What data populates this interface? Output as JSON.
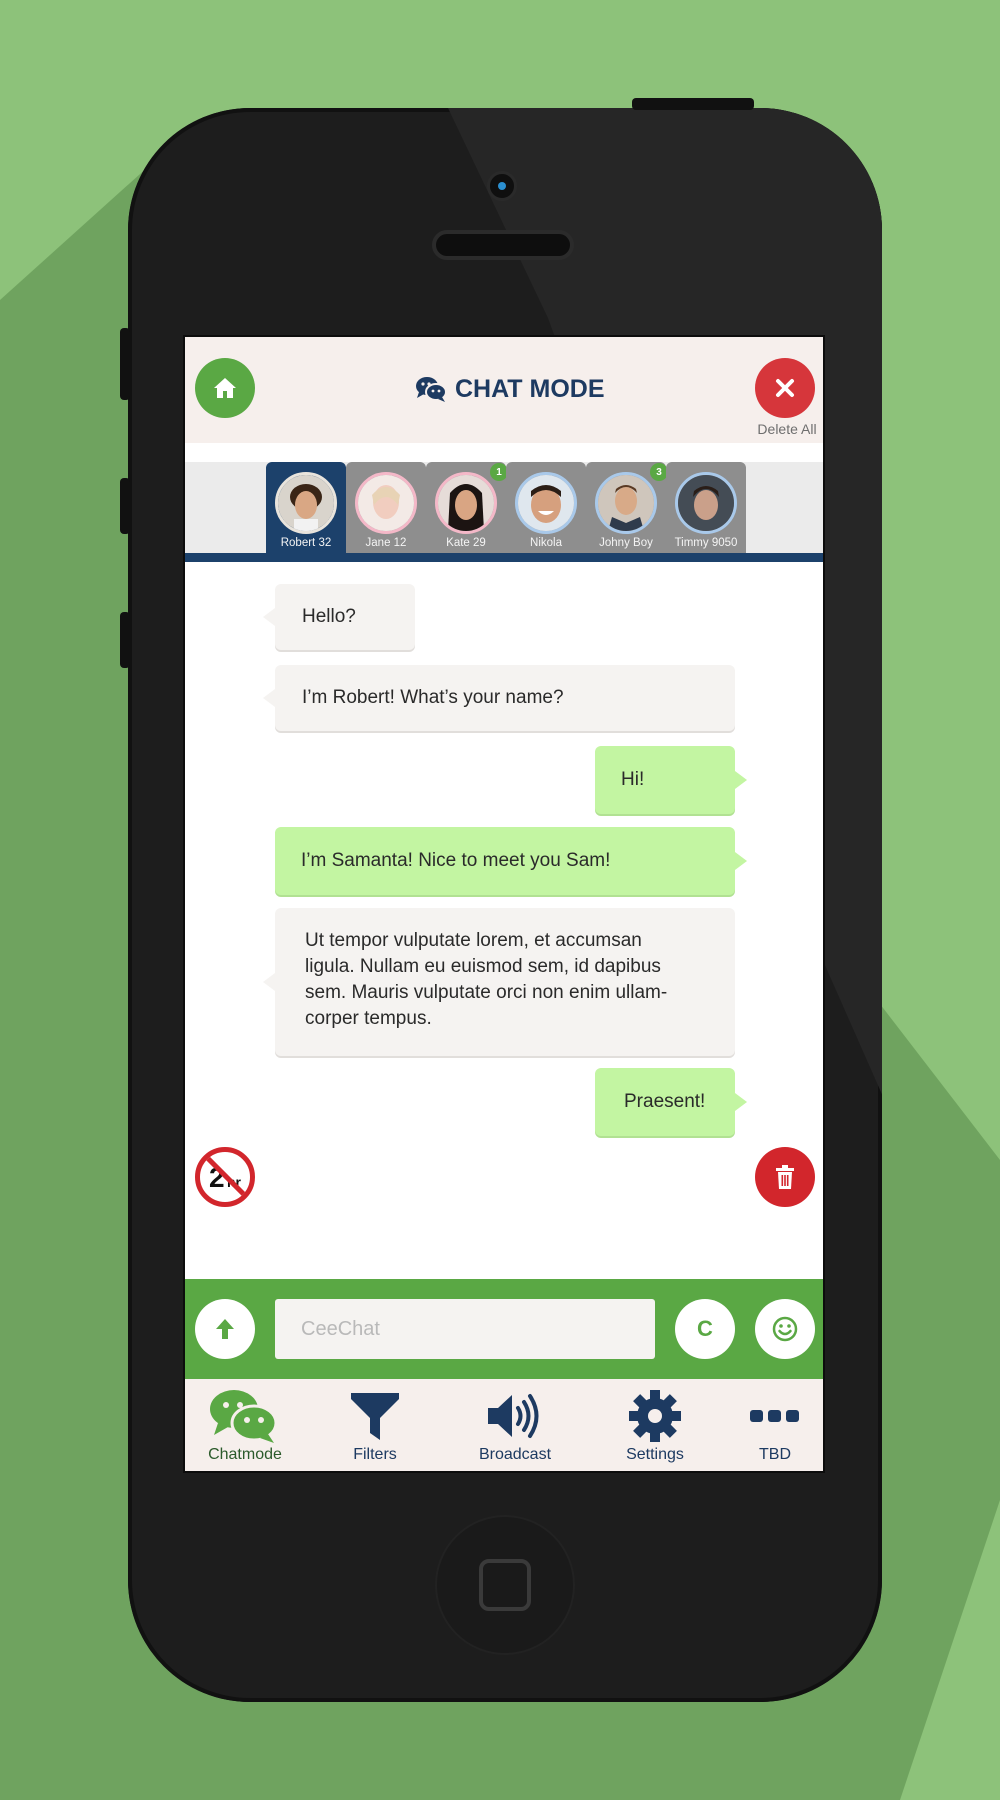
{
  "header": {
    "title": "CHAT MODE",
    "delete_all_label": "Delete All"
  },
  "contacts": [
    {
      "name": "Robert 32",
      "badge": "",
      "active": true
    },
    {
      "name": "Jane 12",
      "badge": ""
    },
    {
      "name": "Kate 29",
      "badge": "1"
    },
    {
      "name": "Nikola",
      "badge": ""
    },
    {
      "name": "Johny Boy",
      "badge": "3"
    },
    {
      "name": "Timmy 9050",
      "badge": ""
    }
  ],
  "messages": [
    {
      "text": "Hello?",
      "direction": "in"
    },
    {
      "text": "I’m Robert! What’s your name?",
      "direction": "in"
    },
    {
      "text": "Hi!",
      "direction": "out"
    },
    {
      "text": "I’m Samanta! Nice to meet you Sam!",
      "direction": "out"
    },
    {
      "text_lines": [
        "Ut tempor vulputate lorem, et accumsan",
        "ligula. Nullam eu euismod sem, id dapibus",
        "sem. Mauris vulputate orci non enim ullam-",
        "corper tempus."
      ],
      "direction": "in"
    },
    {
      "text": "Praesent!",
      "direction": "out"
    }
  ],
  "timer": {
    "number": "2",
    "unit": "hr"
  },
  "composer": {
    "placeholder": "CeeChat",
    "value": "",
    "c_button_label": "C"
  },
  "nav": [
    {
      "label": "Chatmode",
      "icon": "chat-bubbles-icon",
      "active": true
    },
    {
      "label": "Filters",
      "icon": "filter-icon"
    },
    {
      "label": "Broadcast",
      "icon": "speaker-icon"
    },
    {
      "label": "Settings",
      "icon": "gear-icon"
    },
    {
      "label": "TBD",
      "icon": "ellipsis-icon"
    }
  ],
  "colors": {
    "accent_green": "#5aa844",
    "navy": "#1c416b",
    "danger_red": "#d6363b",
    "outgoing_bubble": "#c3f5a2",
    "incoming_bubble": "#f5f3f1",
    "background": "#8dc27a"
  }
}
